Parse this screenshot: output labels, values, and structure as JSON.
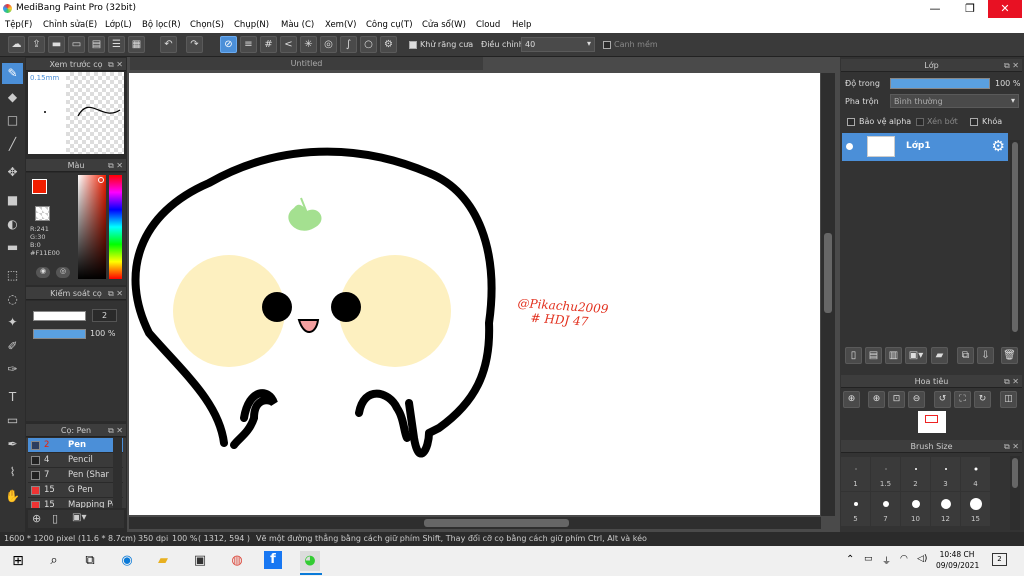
{
  "window": {
    "title": "MediBang Paint Pro (32bit)",
    "minimize": "—",
    "maximize": "❐",
    "close": "✕"
  },
  "menu": [
    "Tệp(F)",
    "Chỉnh sửa(E)",
    "Lớp(L)",
    "Bộ lọc(R)",
    "Chọn(S)",
    "Chụp(N)",
    "Màu (C)",
    "Xem(V)",
    "Công cụ(T)",
    "Cửa sổ(W)",
    "Cloud",
    "Help"
  ],
  "toolbar": {
    "antialias_label": "Khử răng cưa",
    "adjust_label": "Điều chỉnh",
    "adjust_value": "40",
    "edge_label": "Canh mềm"
  },
  "document": {
    "tab_title": "Untitled"
  },
  "preview_panel": {
    "title": "Xem trước cọ",
    "brush_size": "0.15mm"
  },
  "color_panel": {
    "title": "Màu",
    "r": "R:241",
    "g": "G:30",
    "b": "B:0",
    "hex": "#F11E00",
    "colors": {
      "current": "#F11E00"
    }
  },
  "control_panel": {
    "title": "Kiểm soát cọ",
    "size": "2",
    "opacity": "100 %"
  },
  "brush_panel": {
    "title": "Cọ: Pen",
    "items": [
      {
        "size": "2",
        "name": "Pen",
        "color": "#F11E00",
        "selected": true
      },
      {
        "size": "4",
        "name": "Pencil",
        "color": "#222222",
        "selected": false
      },
      {
        "size": "7",
        "name": "Pen (Shar",
        "color": "#222222",
        "selected": false
      },
      {
        "size": "15",
        "name": "G Pen",
        "color": "#e33333",
        "selected": false
      },
      {
        "size": "15",
        "name": "Mapping Pen",
        "color": "#e33333",
        "selected": false
      }
    ]
  },
  "layer_panel": {
    "title": "Lớp",
    "opacity_label": "Độ trong",
    "opacity_value": "100 %",
    "blend_label": "Pha trộn",
    "blend_value": "Bình thường",
    "protect_alpha": "Bảo vệ alpha",
    "clipping": "Xén bớt",
    "lock": "Khóa",
    "layers": [
      {
        "name": "Lớp1"
      }
    ]
  },
  "navigator": {
    "title": "Hoa tiêu"
  },
  "brush_size_panel": {
    "title": "Brush Size",
    "sizes": [
      "1",
      "1.5",
      "2",
      "3",
      "4",
      "5",
      "7",
      "10",
      "12",
      "15"
    ]
  },
  "canvas_text": {
    "signature_line1": "@Pikachu2009",
    "signature_line2": "# HDJ 47"
  },
  "status": {
    "size": "1600 * 1200 pixel",
    "physical": "(11.6 * 8.7cm)",
    "dpi": "350 dpi",
    "zoom": "100 %",
    "coords": "( 1312, 594 )",
    "hint": "Vẽ một đường thẳng bằng cách giữ phím Shift, Thay đổi cỡ cọ bằng cách giữ phím Ctrl, Alt và kéo"
  },
  "taskbar": {
    "time": "10:48 CH",
    "date": "09/09/2021",
    "notifications": "2"
  }
}
